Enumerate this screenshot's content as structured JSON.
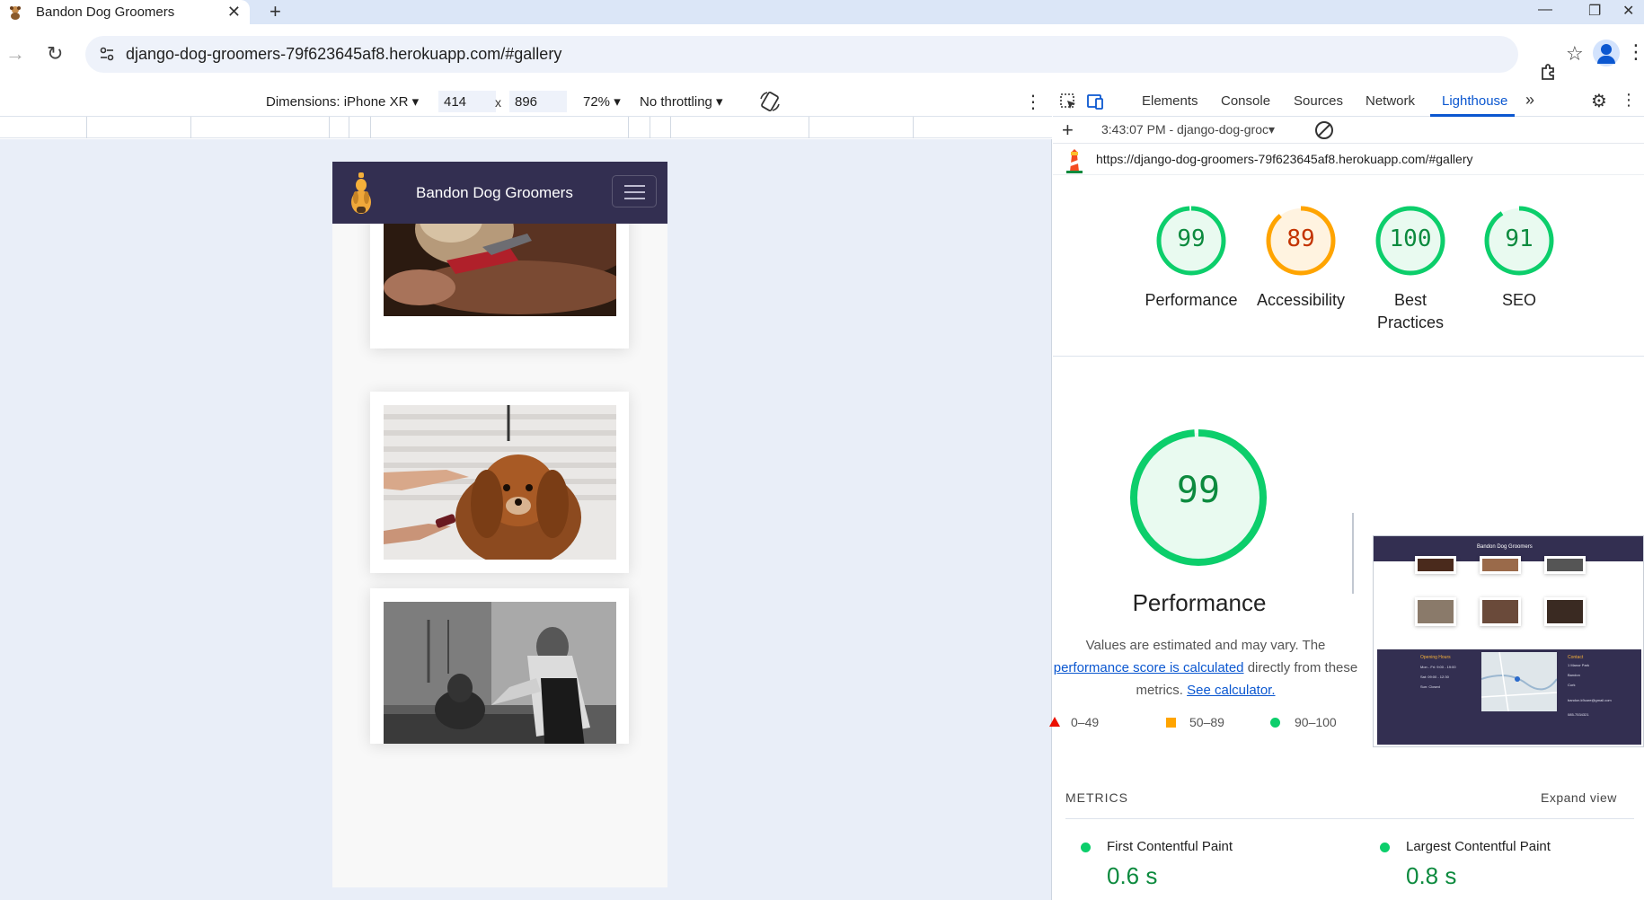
{
  "browser": {
    "tab_title": "Bandon Dog Groomers",
    "url": "django-dog-groomers-79f623645af8.herokuapp.com/#gallery"
  },
  "device_toolbar": {
    "device": "Dimensions: iPhone XR",
    "width": "414",
    "height": "896",
    "zoom": "72%",
    "throttling": "No throttling",
    "dim_separator": "x"
  },
  "site": {
    "brand": "Bandon Dog Groomers",
    "gallery_photos": [
      "dog-nail-clipping",
      "spaniel-grooming",
      "dog-bathing"
    ]
  },
  "devtools": {
    "tabs": [
      "Elements",
      "Console",
      "Sources",
      "Network",
      "Lighthouse"
    ],
    "active_tab": "Lighthouse",
    "report_select": "3:43:07 PM - django-dog-groc▾",
    "report_url": "https://django-dog-groomers-79f623645af8.herokuapp.com/#gallery"
  },
  "lighthouse": {
    "scores": [
      {
        "label": "Performance",
        "value": 99,
        "color": "#0cce6b",
        "text_color": "#0c8a3e"
      },
      {
        "label": "Accessibility",
        "value": 89,
        "color": "#ffa400",
        "text_color": "#c33300"
      },
      {
        "label": "Best Practices",
        "value": 100,
        "color": "#0cce6b",
        "text_color": "#0c8a3e"
      },
      {
        "label": "SEO",
        "value": 91,
        "color": "#0cce6b",
        "text_color": "#0c8a3e"
      }
    ],
    "performance": {
      "score": "99",
      "title": "Performance",
      "desc_pre": "Values are estimated and may vary. The",
      "desc_link1": "performance score is calculated",
      "desc_mid": "directly from these metrics.",
      "desc_link2": "See calculator."
    },
    "legend": [
      "0–49",
      "50–89",
      "90–100"
    ],
    "metrics_heading": "METRICS",
    "expand_view": "Expand view",
    "metrics": [
      {
        "label": "First Contentful Paint",
        "value": "0.6 s"
      },
      {
        "label": "Largest Contentful Paint",
        "value": "0.8 s"
      }
    ],
    "thumbnail": {
      "brand": "Bandon Dog Groomers",
      "hours_heading": "Opening Hours",
      "hours": [
        "Mon - Fri: 9:00 - 19:00",
        "Sat: 09:00 - 12:30",
        "Sun: Closed"
      ],
      "contact_heading": "Contact",
      "contact": [
        "1 Manor Park",
        "Bandon",
        "Cork",
        "bandon.k9care@gmail.com",
        "085-7534321"
      ]
    }
  }
}
